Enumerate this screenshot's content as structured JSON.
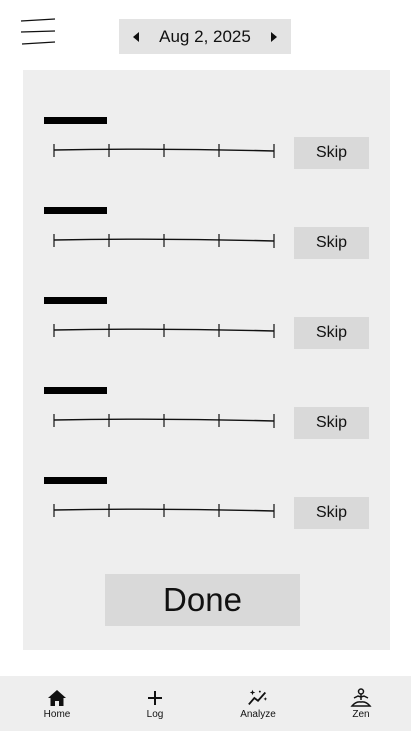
{
  "header": {
    "date": "Aug 2, 2025",
    "prev_icon": "caret-left-icon",
    "next_icon": "caret-right-icon",
    "menu_icon": "hamburger-menu-icon"
  },
  "items": [
    {
      "skip_label": "Skip"
    },
    {
      "skip_label": "Skip"
    },
    {
      "skip_label": "Skip"
    },
    {
      "skip_label": "Skip"
    },
    {
      "skip_label": "Skip"
    }
  ],
  "done_label": "Done",
  "nav": {
    "home": {
      "label": "Home",
      "icon": "home-icon"
    },
    "log": {
      "label": "Log",
      "icon": "plus-icon"
    },
    "analyze": {
      "label": "Analyze",
      "icon": "sparkle-chart-icon"
    },
    "zen": {
      "label": "Zen",
      "icon": "meditation-icon"
    }
  },
  "colors": {
    "panel_bg": "#eeeeee",
    "button_bg": "#d9d9d9",
    "date_bg": "#e3e3e3",
    "nav_bg": "#eeeeee"
  }
}
